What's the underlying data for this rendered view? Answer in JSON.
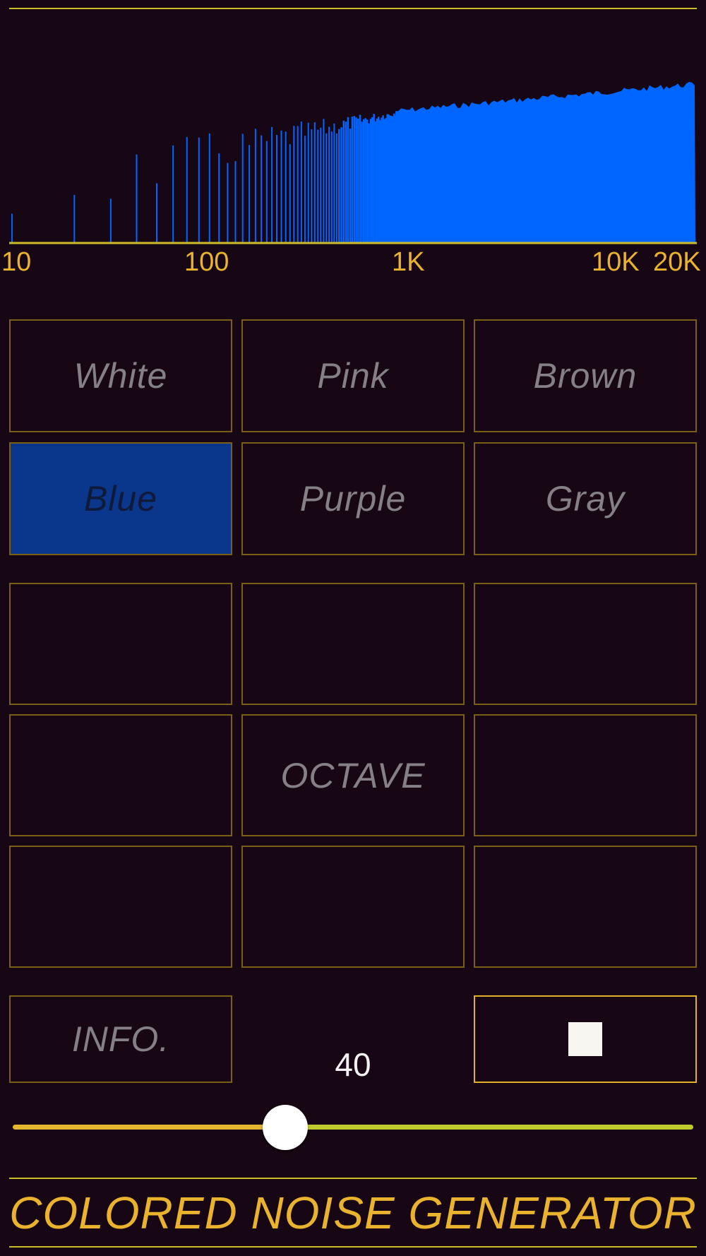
{
  "spectrum": {
    "axis_labels": [
      "10",
      "100",
      "1K",
      "10K",
      "20K"
    ],
    "bar_color": "#0066ff",
    "line_color": "#cbbd2a"
  },
  "noise_types": [
    {
      "label": "White",
      "selected": false
    },
    {
      "label": "Pink",
      "selected": false
    },
    {
      "label": "Brown",
      "selected": false
    },
    {
      "label": "Blue",
      "selected": true
    },
    {
      "label": "Purple",
      "selected": false
    },
    {
      "label": "Gray",
      "selected": false
    }
  ],
  "octave_grid": {
    "center_label": "OCTAVE"
  },
  "controls": {
    "info_label": "INFO.",
    "volume_value": "40",
    "volume_fraction": 0.4,
    "stop_icon": "stop-icon"
  },
  "footer": {
    "title": "COLORED NOISE GENERATOR"
  },
  "colors": {
    "accent_gold": "#e9b32d",
    "selected_blue": "#0a378b",
    "background": "#170613"
  }
}
